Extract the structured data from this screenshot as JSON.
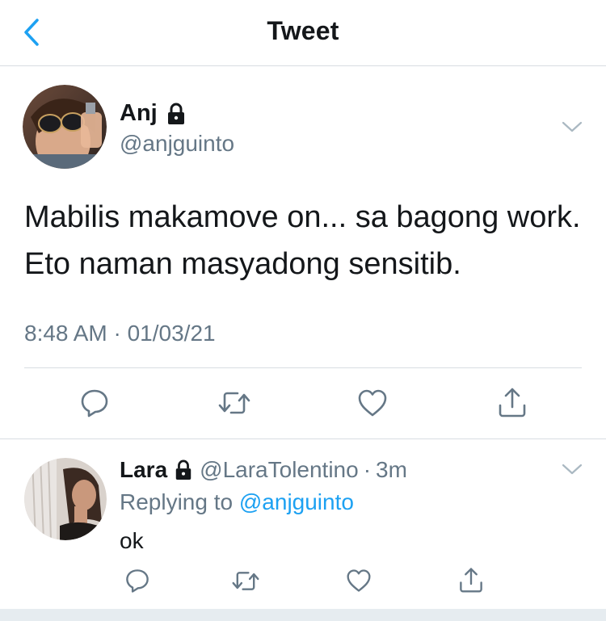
{
  "header": {
    "title": "Tweet"
  },
  "tweet": {
    "author_name": "Anj",
    "author_handle": "@anjguinto",
    "text": "Mabilis makamove on... sa bagong work. Eto naman masyadong sensitib.",
    "timestamp": "8:48 AM · 01/03/21"
  },
  "reply": {
    "author_name": "Lara",
    "author_handle": "@LaraTolentino",
    "separator": "·",
    "age": "3m",
    "replying_prefix": "Replying to ",
    "replying_to": "@anjguinto",
    "text": "ok"
  },
  "icons": {
    "back": "chevron-left-icon",
    "lock": "lock-icon",
    "more": "chevron-down-icon",
    "reply": "comment-icon",
    "retweet": "retweet-icon",
    "like": "heart-icon",
    "share": "share-icon"
  },
  "colors": {
    "accent": "#1da1f2",
    "text": "#14171a",
    "secondary": "#657786",
    "divider": "#d8dde2"
  }
}
